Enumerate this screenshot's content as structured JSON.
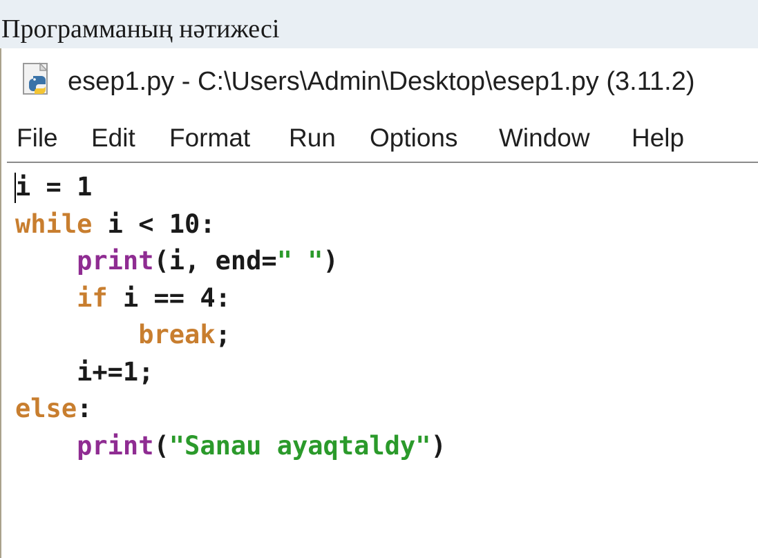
{
  "document": {
    "caption": "Программаның нәтижесі"
  },
  "window": {
    "title": "esep1.py - C:\\Users\\Admin\\Desktop\\esep1.py (3.11.2)",
    "icon": "python-file-icon"
  },
  "menu": {
    "items": [
      "File",
      "Edit",
      "Format",
      "Run",
      "Options",
      "Window",
      "Help"
    ]
  },
  "editor": {
    "lines": [
      [
        {
          "t": "i = 1",
          "c": "plain"
        }
      ],
      [
        {
          "t": "while",
          "c": "kw"
        },
        {
          "t": " i < 10:",
          "c": "plain"
        }
      ],
      [
        {
          "t": "    ",
          "c": "plain"
        },
        {
          "t": "print",
          "c": "bi"
        },
        {
          "t": "(i, end=",
          "c": "plain"
        },
        {
          "t": "\" \"",
          "c": "str"
        },
        {
          "t": ")",
          "c": "plain"
        }
      ],
      [
        {
          "t": "    ",
          "c": "plain"
        },
        {
          "t": "if",
          "c": "kw"
        },
        {
          "t": " i == 4:",
          "c": "plain"
        }
      ],
      [
        {
          "t": "        ",
          "c": "plain"
        },
        {
          "t": "break",
          "c": "kw"
        },
        {
          "t": ";",
          "c": "plain"
        }
      ],
      [
        {
          "t": "    i+=1;",
          "c": "plain"
        }
      ],
      [
        {
          "t": "else",
          "c": "kw"
        },
        {
          "t": ":",
          "c": "plain"
        }
      ],
      [
        {
          "t": "    ",
          "c": "plain"
        },
        {
          "t": "print",
          "c": "bi"
        },
        {
          "t": "(",
          "c": "plain"
        },
        {
          "t": "\"Sanau ayaqtaldy\"",
          "c": "str"
        },
        {
          "t": ")",
          "c": "plain"
        }
      ]
    ]
  },
  "colors": {
    "keyword": "#c87e2f",
    "builtin": "#8f2c92",
    "string": "#2b9a2b",
    "text": "#1a1a1a"
  }
}
